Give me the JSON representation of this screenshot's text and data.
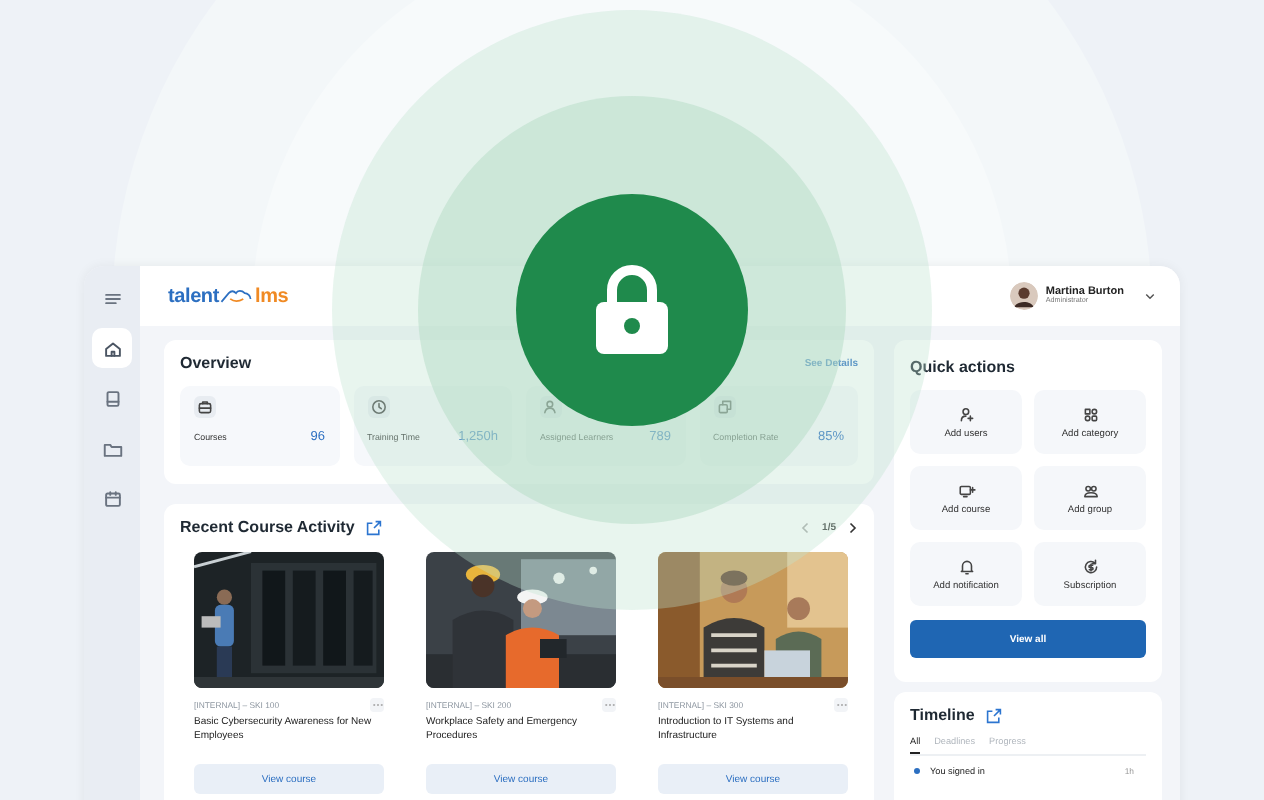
{
  "sidebar": {
    "items": [
      {
        "kind": "menu",
        "selected": false
      },
      {
        "kind": "home",
        "selected": true
      },
      {
        "kind": "book",
        "selected": false
      },
      {
        "kind": "folder",
        "selected": false
      },
      {
        "kind": "calendar",
        "selected": false
      }
    ]
  },
  "header": {
    "logo": {
      "left": "talent",
      "right": "lms"
    },
    "user": {
      "name": "Martina Burton",
      "role": "Administrator"
    }
  },
  "overview": {
    "title": "Overview",
    "link": "See Details",
    "stats": [
      {
        "kind": "courses",
        "label": "Courses",
        "value": "96"
      },
      {
        "kind": "time",
        "label": "Training Time",
        "value": "1,250h"
      },
      {
        "kind": "learners",
        "label": "Assigned Learners",
        "value": "789"
      },
      {
        "kind": "completion",
        "label": "Completion Rate",
        "value": "85%"
      }
    ]
  },
  "recent": {
    "title": "Recent Course Activity",
    "pager": "1/5",
    "courses": [
      {
        "kind": "picture",
        "code": "[INTERNAL] – SKI 100",
        "title": "Basic Cybersecurity Awareness for New Employees",
        "button": "View course"
      },
      {
        "kind": "picture",
        "code": "[INTERNAL] – SKI 200",
        "title": "Workplace Safety and Emergency Procedures",
        "button": "View course"
      },
      {
        "kind": "picture",
        "code": "[INTERNAL] – SKI 300",
        "title": "Introduction to IT Systems and Infrastructure",
        "button": "View course"
      }
    ]
  },
  "quick_actions": {
    "title": "Quick actions",
    "actions": [
      {
        "kind": "user",
        "label": "Add users"
      },
      {
        "kind": "category",
        "label": "Add category"
      },
      {
        "kind": "course",
        "label": "Add course"
      },
      {
        "kind": "group",
        "label": "Add group"
      },
      {
        "kind": "bell",
        "label": "Add notification"
      },
      {
        "kind": "subscription",
        "label": "Subscription"
      }
    ],
    "button": "View all"
  },
  "timeline": {
    "title": "Timeline",
    "tabs": [
      {
        "label": "All",
        "selected": true
      },
      {
        "label": "Deadlines",
        "selected": false
      },
      {
        "label": "Progress",
        "selected": false
      }
    ],
    "events": [
      {
        "text": "You signed in",
        "time": "1h"
      }
    ]
  }
}
